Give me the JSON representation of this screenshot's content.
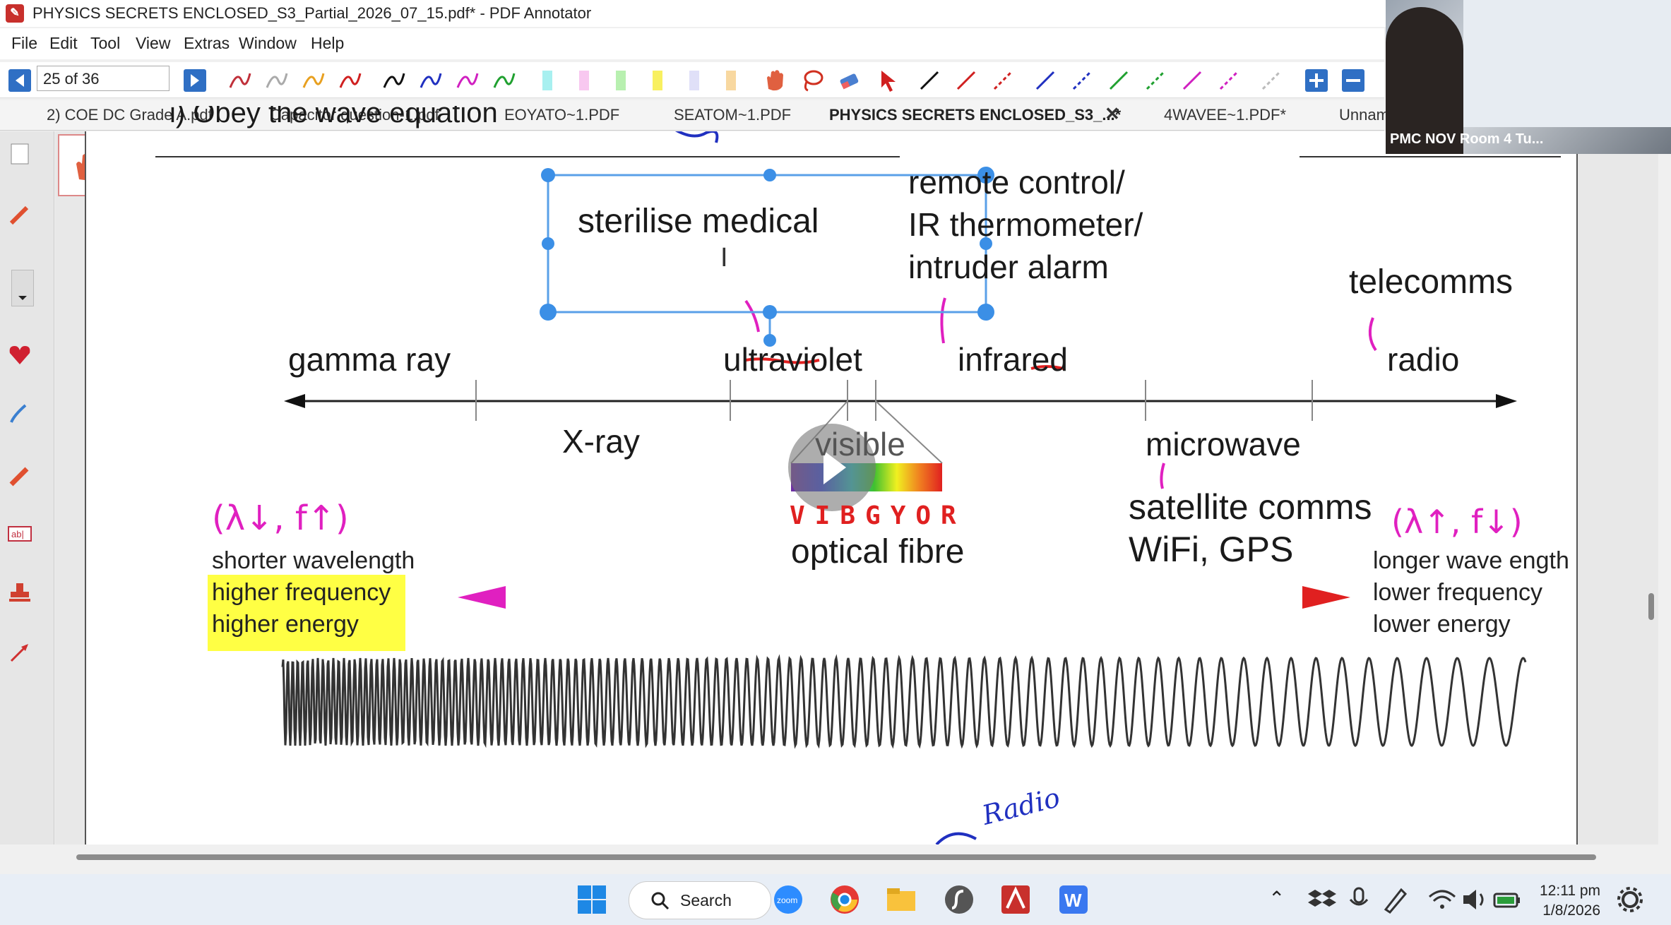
{
  "window": {
    "title": "PHYSICS SECRETS ENCLOSED_S3_Partial_2026_07_15.pdf* - PDF Annotator"
  },
  "menu": {
    "items": [
      "File",
      "Edit",
      "Tool",
      "View",
      "Extras",
      "Window",
      "Help"
    ]
  },
  "toolbar": {
    "page_indicator": "25 of 36"
  },
  "tabs": [
    {
      "label": "2) COE DC Grade A.pdf"
    },
    {
      "label": "Capacitor question-1.pdf"
    },
    {
      "label": "EOYATO~1.PDF"
    },
    {
      "label": "SEATOM~1.PDF"
    },
    {
      "label": "PHYSICS SECRETS ENCLOSED_S3_...*"
    },
    {
      "label": "4WAVEE~1.PDF*"
    },
    {
      "label": "Unnam"
    }
  ],
  "webcam": {
    "label": "PMC NOV Room 4 Tu..."
  },
  "document": {
    "header_partial": "i) Obey the wave equation",
    "selected_textbox": "sterilise medical",
    "ir_uses": [
      "remote control/",
      "IR thermometer/",
      "intruder alarm"
    ],
    "telecomms": "telecomms",
    "spectrum_top": [
      "gamma ray",
      "ultraviolet",
      "infrared",
      "radio"
    ],
    "spectrum_bottom": [
      "X-ray",
      "visible",
      "microwave"
    ],
    "vibgyor": "VIBGYOR",
    "optical_fibre": "optical fibre",
    "satellite": [
      "satellite comms",
      "WiFi, GPS"
    ],
    "left_note": "(λ↓, f↑)",
    "right_note": "(λ↑, f↓)",
    "left_props": [
      "shorter wavelength",
      "higher frequency",
      "higher energy"
    ],
    "right_props": [
      "longer wave ength",
      "lower frequency",
      "lower energy"
    ],
    "radio_note": "Radio"
  },
  "taskbar": {
    "search_label": "Search",
    "time": "12:11 pm",
    "date": "1/8/2026"
  },
  "colors": {
    "accent_blue": "#3b8fe6",
    "annotation_magenta": "#e020c0",
    "annotation_red": "#e02020",
    "highlight_yellow": "#ffff30"
  }
}
